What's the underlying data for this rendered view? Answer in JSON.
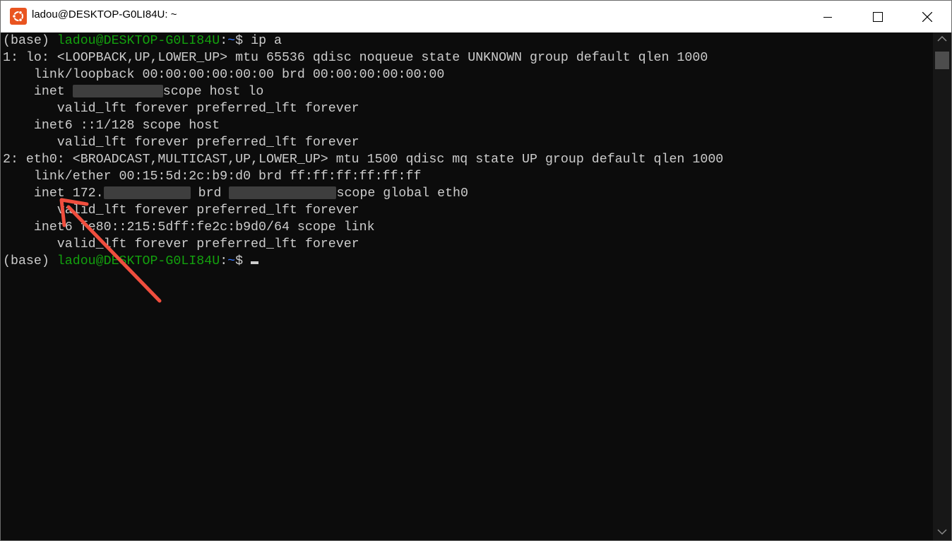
{
  "window": {
    "title": "ladou@DESKTOP-G0LI84U: ~"
  },
  "colors": {
    "prompt_green": "#13a10e",
    "path_blue": "#3b78ff",
    "terminal_bg": "#0c0c0c",
    "terminal_fg": "#cccccc",
    "annotation_red": "#f04e3e"
  },
  "icons": {
    "app": "ubuntu-icon",
    "min": "minimize-icon",
    "max": "maximize-icon",
    "close": "close-icon",
    "scroll_up": "scroll-up-arrow-icon",
    "scroll_down": "scroll-down-arrow-icon",
    "annotation": "red-arrow-icon"
  },
  "prompt": {
    "env": "(base) ",
    "user_host": "ladou@DESKTOP-G0LI84U",
    "colon": ":",
    "path": "~",
    "symbol": "$ "
  },
  "command": "ip a",
  "output": {
    "l1": "1: lo: <LOOPBACK,UP,LOWER_UP> mtu 65536 qdisc noqueue state UNKNOWN group default qlen 1000",
    "l2": "    link/loopback 00:00:00:00:00:00 brd 00:00:00:00:00:00",
    "l3_a": "    inet ",
    "l3_b": "scope host lo",
    "l4": "       valid_lft forever preferred_lft forever",
    "l5": "    inet6 ::1/128 scope host",
    "l6": "       valid_lft forever preferred_lft forever",
    "l7": "2: eth0: <BROADCAST,MULTICAST,UP,LOWER_UP> mtu 1500 qdisc mq state UP group default qlen 1000",
    "l8": "    link/ether 00:15:5d:2c:b9:d0 brd ff:ff:ff:ff:ff:ff",
    "l9_a": "    inet 172.",
    "l9_b": " brd ",
    "l9_c": "scope global eth0",
    "l10": "       valid_lft forever preferred_lft forever",
    "l11": "    inet6 fe80::215:5dff:fe2c:b9d0/64 scope link",
    "l12": "       valid_lft forever preferred_lft forever"
  }
}
